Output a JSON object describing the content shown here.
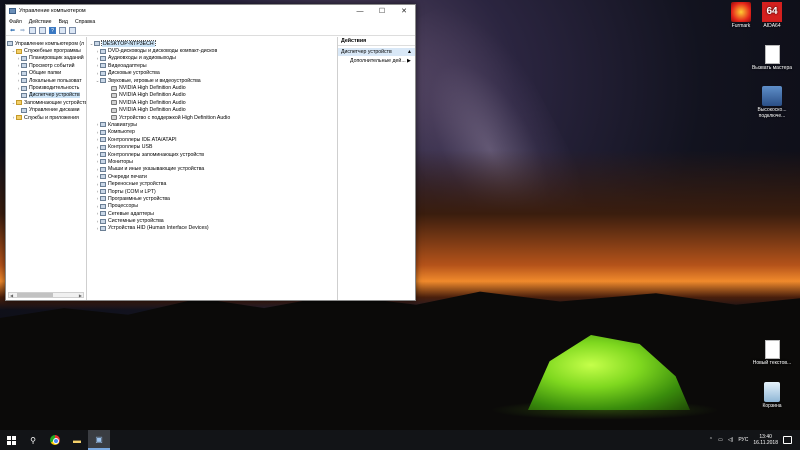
{
  "window": {
    "title": "Управление компьютером",
    "menu": [
      "Файл",
      "Действие",
      "Вид",
      "Справка"
    ],
    "controls": {
      "minimize": "—",
      "maximize": "☐",
      "close": "✕"
    }
  },
  "tree": {
    "root": "Управление компьютером (л",
    "items": [
      {
        "label": "Служебные программы",
        "level": 1,
        "exp": "⌄"
      },
      {
        "label": "Планировщик заданий",
        "level": 2,
        "exp": "›"
      },
      {
        "label": "Просмотр событий",
        "level": 2,
        "exp": "›"
      },
      {
        "label": "Общие папки",
        "level": 2,
        "exp": "›"
      },
      {
        "label": "Локальные пользоват",
        "level": 2,
        "exp": "›"
      },
      {
        "label": "Производительность",
        "level": 2,
        "exp": "›"
      },
      {
        "label": "Диспетчер устройств",
        "level": 2,
        "exp": "",
        "selected": true
      },
      {
        "label": "Запоминающие устройства",
        "level": 1,
        "exp": "⌄"
      },
      {
        "label": "Управление дисками",
        "level": 2,
        "exp": ""
      },
      {
        "label": "Службы и приложения",
        "level": 1,
        "exp": "›"
      }
    ]
  },
  "devices": {
    "root": "DESKTOP-NTP3ECH",
    "categories": [
      {
        "label": "DVD-дисководы и дисководы компакт-дисков",
        "children": []
      },
      {
        "label": "Аудиовходы и аудиовыходы",
        "children": []
      },
      {
        "label": "Видеоадаптеры",
        "children": []
      },
      {
        "label": "Дисковые устройства",
        "children": []
      },
      {
        "label": "Звуковые, игровые и видеоустройства",
        "expanded": true,
        "children": [
          "NVIDIA High Definition Audio",
          "NVIDIA High Definition Audio",
          "NVIDIA High Definition Audio",
          "NVIDIA High Definition Audio",
          "Устройство с поддержкой High Definition Audio"
        ]
      },
      {
        "label": "Клавиатуры",
        "children": []
      },
      {
        "label": "Компьютер",
        "children": []
      },
      {
        "label": "Контроллеры IDE ATA/ATAPI",
        "children": []
      },
      {
        "label": "Контроллеры USB",
        "children": []
      },
      {
        "label": "Контроллеры запоминающих устройств",
        "children": []
      },
      {
        "label": "Мониторы",
        "children": []
      },
      {
        "label": "Мыши и иные указывающие устройства",
        "children": []
      },
      {
        "label": "Очереди печати",
        "children": []
      },
      {
        "label": "Переносные устройства",
        "children": []
      },
      {
        "label": "Порты (COM и LPT)",
        "children": []
      },
      {
        "label": "Программные устройства",
        "children": []
      },
      {
        "label": "Процессоры",
        "children": []
      },
      {
        "label": "Сетевые адаптеры",
        "children": []
      },
      {
        "label": "Системные устройства",
        "children": []
      },
      {
        "label": "Устройства HID (Human Interface Devices)",
        "children": []
      }
    ]
  },
  "actions": {
    "header": "Действия",
    "section": "Диспетчер устройств",
    "more": "Дополнительные дей..."
  },
  "desktop": {
    "icons": [
      {
        "label": "Furmark",
        "kind": "furmark",
        "glyph": ""
      },
      {
        "label": "AIDA64",
        "kind": "aida",
        "glyph": "64"
      },
      {
        "label": "Вызвать мастера",
        "kind": "doc",
        "glyph": ""
      },
      {
        "label": "Высокоско... подключе...",
        "kind": "net",
        "glyph": ""
      },
      {
        "label": "Новый текстов...",
        "kind": "doc",
        "glyph": ""
      },
      {
        "label": "Корзина",
        "kind": "bin",
        "glyph": ""
      }
    ]
  },
  "taskbar": {
    "lang": "РУС",
    "time": "13:40",
    "date": "16.11.2018"
  }
}
